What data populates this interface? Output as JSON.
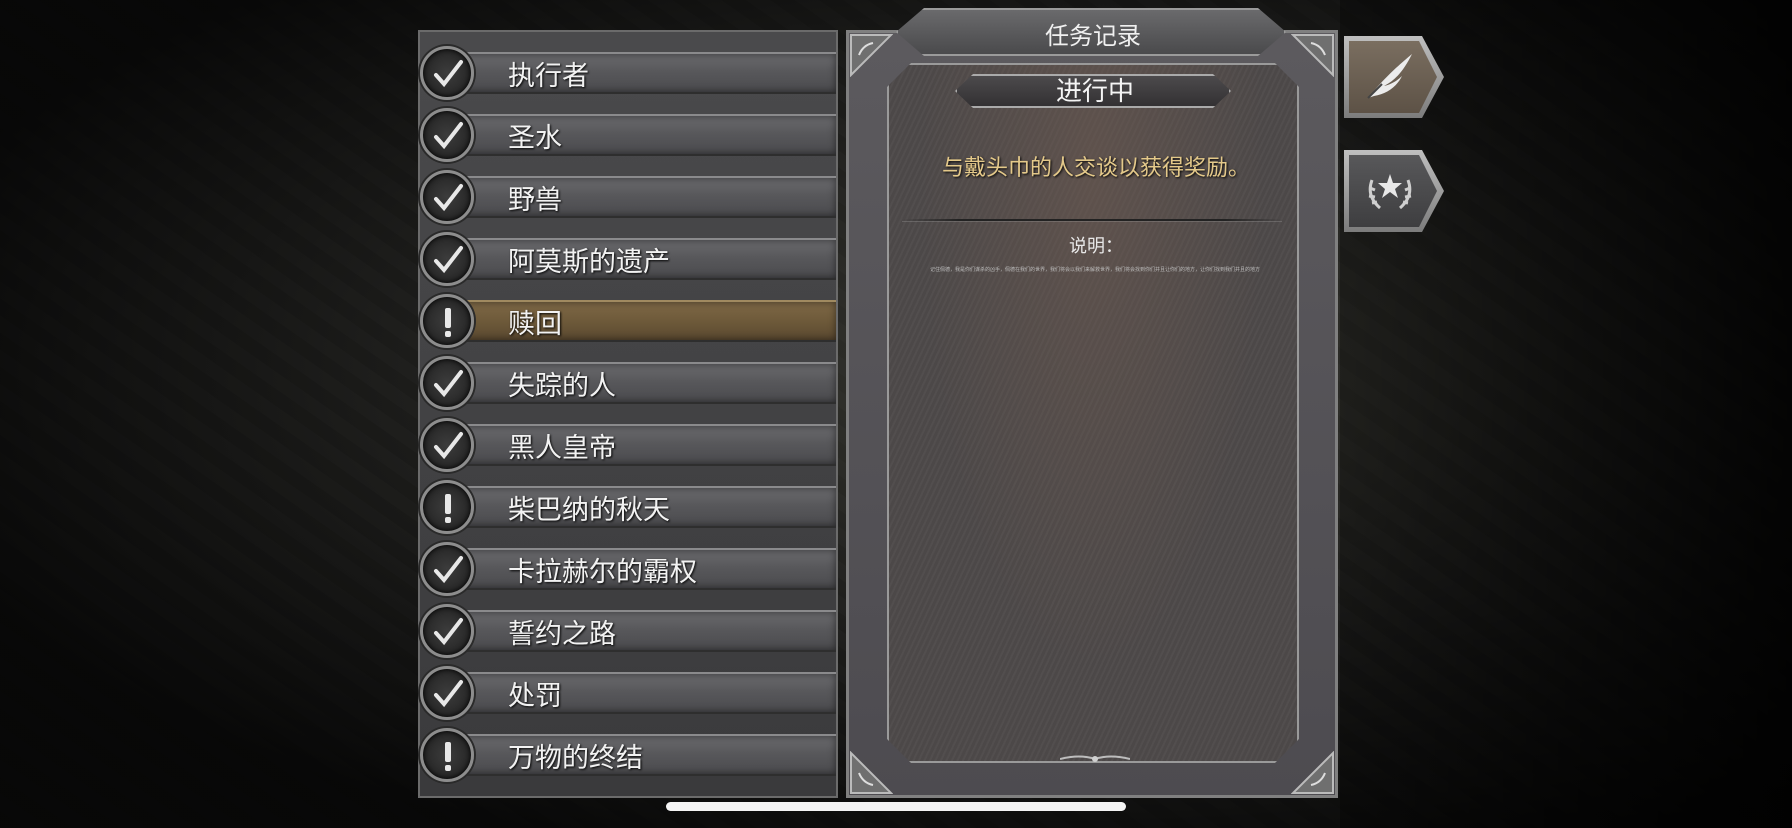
{
  "journal": {
    "title": "任务记录",
    "status": "进行中",
    "objective": "与戴头巾的人交谈以获得奖励。",
    "description_label": "说明：",
    "description_text": "记住佩德，我是你们谋杀的凶手，佩德在我们的世界，我们将会以我们来解救世界，我们将会找到你们并且让你们的地方，让你们找到我们并且的地方，这是我们与佩德的"
  },
  "quests": [
    {
      "label": "执行者",
      "state": "completed",
      "icon": "checkmark-icon"
    },
    {
      "label": "圣水",
      "state": "completed",
      "icon": "checkmark-icon"
    },
    {
      "label": "野兽",
      "state": "completed",
      "icon": "checkmark-icon"
    },
    {
      "label": "阿莫斯的遗产",
      "state": "completed",
      "icon": "checkmark-icon"
    },
    {
      "label": "赎回",
      "state": "in-progress",
      "icon": "exclamation-icon",
      "selected": true
    },
    {
      "label": "失踪的人",
      "state": "completed",
      "icon": "checkmark-icon"
    },
    {
      "label": "黑人皇帝",
      "state": "completed",
      "icon": "checkmark-icon"
    },
    {
      "label": "柴巴纳的秋天",
      "state": "in-progress",
      "icon": "exclamation-icon"
    },
    {
      "label": "卡拉赫尔的霸权",
      "state": "completed",
      "icon": "checkmark-icon"
    },
    {
      "label": "誓约之路",
      "state": "completed",
      "icon": "checkmark-icon"
    },
    {
      "label": "处罚",
      "state": "completed",
      "icon": "checkmark-icon"
    },
    {
      "label": "万物的终结",
      "state": "in-progress",
      "icon": "exclamation-icon"
    }
  ],
  "tabs": [
    {
      "icon": "quill-icon",
      "active": true
    },
    {
      "icon": "laurel-star-icon",
      "active": false
    }
  ],
  "colors": {
    "objective_text": "#e4c98a",
    "selected_row": "#7e6846"
  }
}
